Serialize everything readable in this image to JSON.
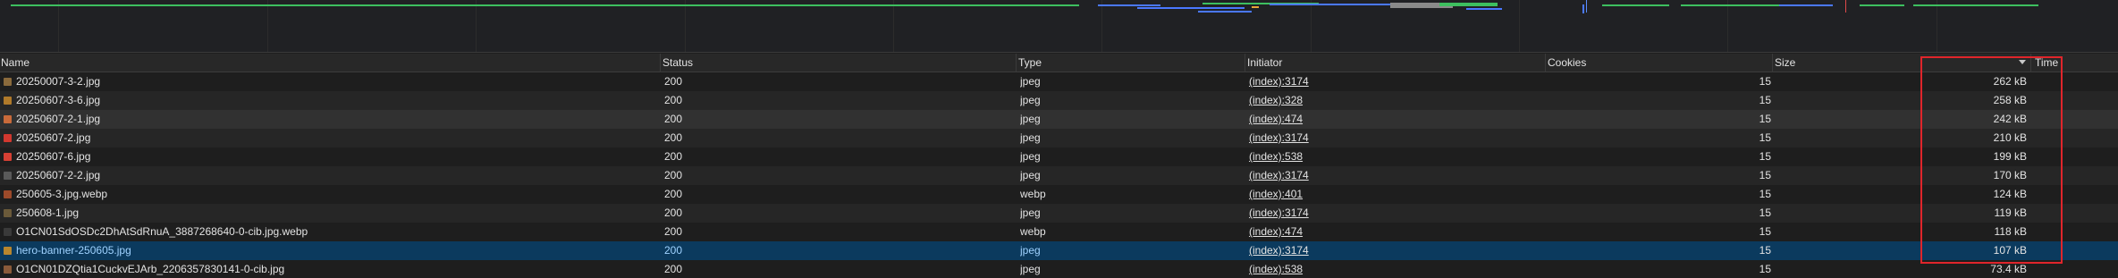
{
  "columns": {
    "name": "Name",
    "status": "Status",
    "type": "Type",
    "initiator": "Initiator",
    "cookies": "Cookies",
    "size": "Size",
    "time": "Time"
  },
  "sort": {
    "column": "Size",
    "direction": "descending"
  },
  "selected_row": 9,
  "rows": [
    {
      "name": "20250007-3-2.jpg",
      "status": "200",
      "type": "jpeg",
      "initiator": "(index):3174",
      "cookies": "15",
      "size": "262 kB",
      "icon_color": "#8a6a3c"
    },
    {
      "name": "20250607-3-6.jpg",
      "status": "200",
      "type": "jpeg",
      "initiator": "(index):328",
      "cookies": "15",
      "size": "258 kB",
      "icon_color": "#b07a2a"
    },
    {
      "name": "20250607-2-1.jpg",
      "status": "200",
      "type": "jpeg",
      "initiator": "(index):474",
      "cookies": "15",
      "size": "242 kB",
      "icon_color": "#c96a3a"
    },
    {
      "name": "20250607-2.jpg",
      "status": "200",
      "type": "jpeg",
      "initiator": "(index):3174",
      "cookies": "15",
      "size": "210 kB",
      "icon_color": "#d2382f"
    },
    {
      "name": "20250607-6.jpg",
      "status": "200",
      "type": "jpeg",
      "initiator": "(index):538",
      "cookies": "15",
      "size": "199 kB",
      "icon_color": "#d64034"
    },
    {
      "name": "20250607-2-2.jpg",
      "status": "200",
      "type": "jpeg",
      "initiator": "(index):3174",
      "cookies": "15",
      "size": "170 kB",
      "icon_color": "#5a5a5a"
    },
    {
      "name": "250605-3.jpg.webp",
      "status": "200",
      "type": "webp",
      "initiator": "(index):401",
      "cookies": "15",
      "size": "124 kB",
      "icon_color": "#9c4a2a"
    },
    {
      "name": "250608-1.jpg",
      "status": "200",
      "type": "jpeg",
      "initiator": "(index):3174",
      "cookies": "15",
      "size": "119 kB",
      "icon_color": "#6b5a3a"
    },
    {
      "name": "O1CN01SdOSDc2DhAtSdRnuA_3887268640-0-cib.jpg.webp",
      "status": "200",
      "type": "webp",
      "initiator": "(index):474",
      "cookies": "15",
      "size": "118 kB",
      "icon_color": "#3a3a3a"
    },
    {
      "name": "hero-banner-250605.jpg",
      "status": "200",
      "type": "jpeg",
      "initiator": "(index):3174",
      "cookies": "15",
      "size": "107 kB",
      "icon_color": "#b8862e"
    },
    {
      "name": "O1CN01DZQtia1CuckvEJArb_2206357830141-0-cib.jpg",
      "status": "200",
      "type": "jpeg",
      "initiator": "(index):538",
      "cookies": "15",
      "size": "73.4 kB",
      "icon_color": "#8a5a3a"
    }
  ],
  "colors": {
    "selected_row": "#0b3a5e",
    "highlight_box": "#e0252b",
    "overview_green": "#3dbf5f",
    "overview_blue": "#4a78ff"
  }
}
